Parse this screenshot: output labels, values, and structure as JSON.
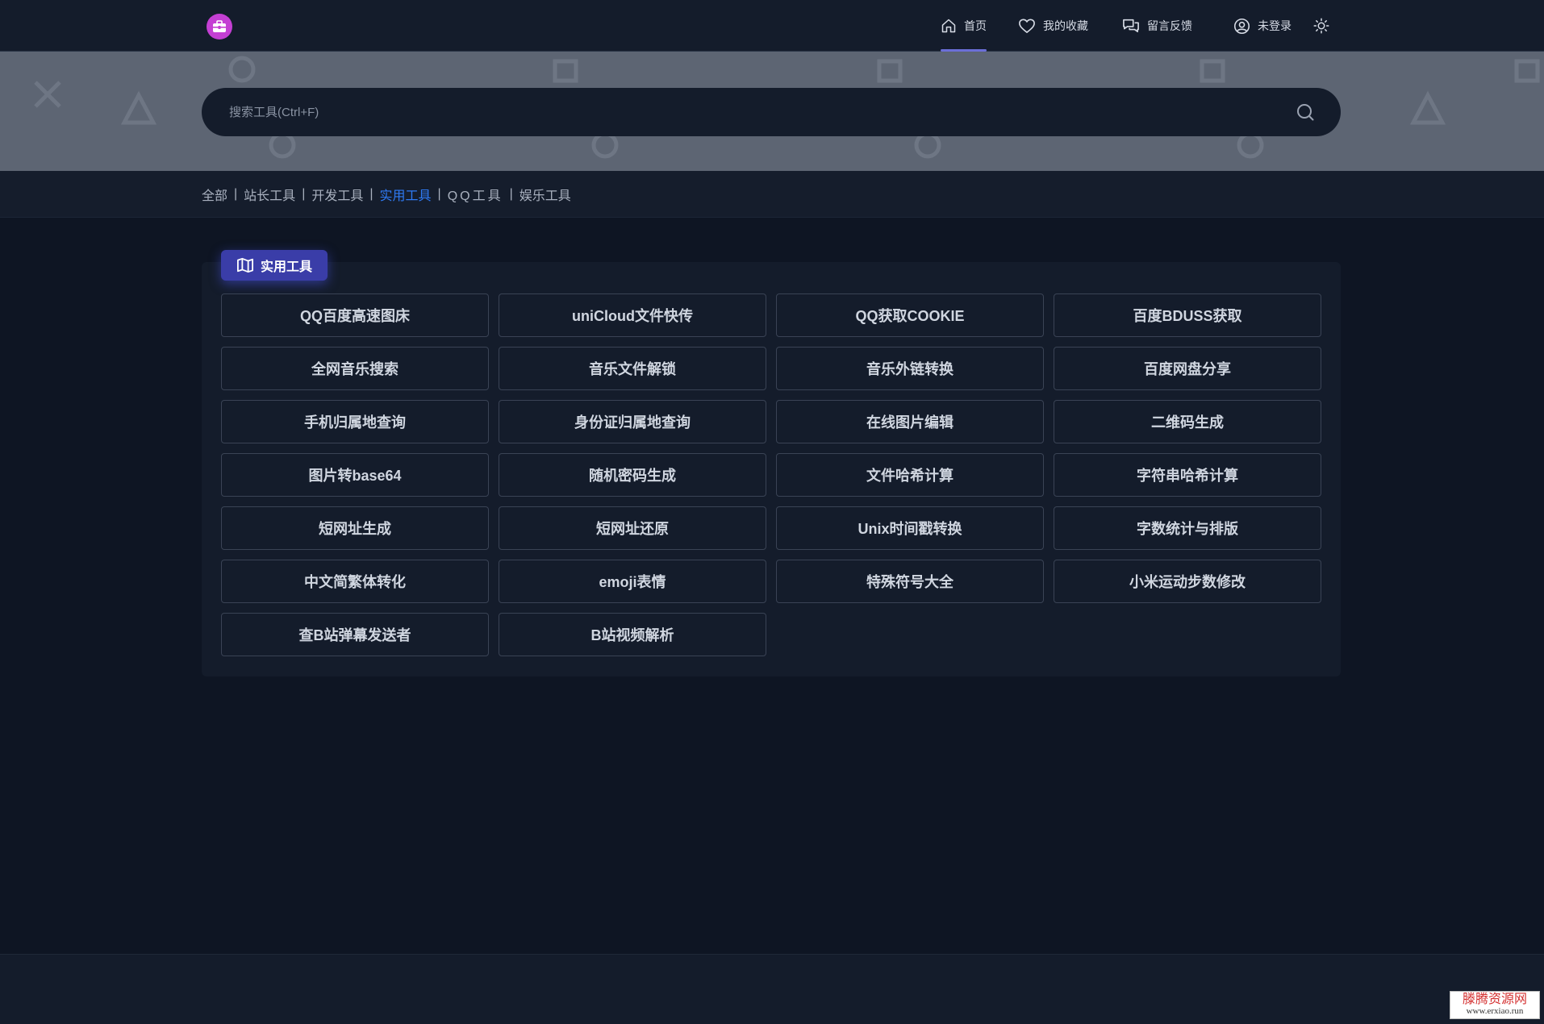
{
  "nav": {
    "items": [
      {
        "label": "首页",
        "icon": "home-icon"
      },
      {
        "label": "我的收藏",
        "icon": "heart-icon"
      },
      {
        "label": "留言反馈",
        "icon": "chat-icon"
      },
      {
        "label": "未登录",
        "icon": "user-icon"
      }
    ],
    "active_index": 0,
    "theme_icon": "sun-icon",
    "logo_color": "#c43fd3",
    "active_indicator_color": "#6b6fd8"
  },
  "search": {
    "placeholder": "搜索工具(Ctrl+F)",
    "value": "",
    "icon": "search-icon"
  },
  "categories": {
    "items": [
      "全部",
      "站长工具",
      "开发工具",
      "实用工具",
      "QQ工具",
      "娱乐工具"
    ],
    "active_index": 3,
    "separator": "|",
    "active_color": "#2f7bf5"
  },
  "panel": {
    "title": "实用工具",
    "icon": "map-icon",
    "badge_color": "#3a3da8",
    "tools": [
      "QQ百度高速图床",
      "uniCloud文件快传",
      "QQ获取COOKIE",
      "百度BDUSS获取",
      "全网音乐搜索",
      "音乐文件解锁",
      "音乐外链转换",
      "百度网盘分享",
      "手机归属地查询",
      "身份证归属地查询",
      "在线图片编辑",
      "二维码生成",
      "图片转base64",
      "随机密码生成",
      "文件哈希计算",
      "字符串哈希计算",
      "短网址生成",
      "短网址还原",
      "Unix时间戳转换",
      "字数统计与排版",
      "中文简繁体转化",
      "emoji表情",
      "特殊符号大全",
      "小米运动步数修改",
      "查B站弹幕发送者",
      "B站视频解析"
    ]
  },
  "watermark": {
    "top": "滕腾资源网",
    "bottom": "www.erxiao.run"
  }
}
